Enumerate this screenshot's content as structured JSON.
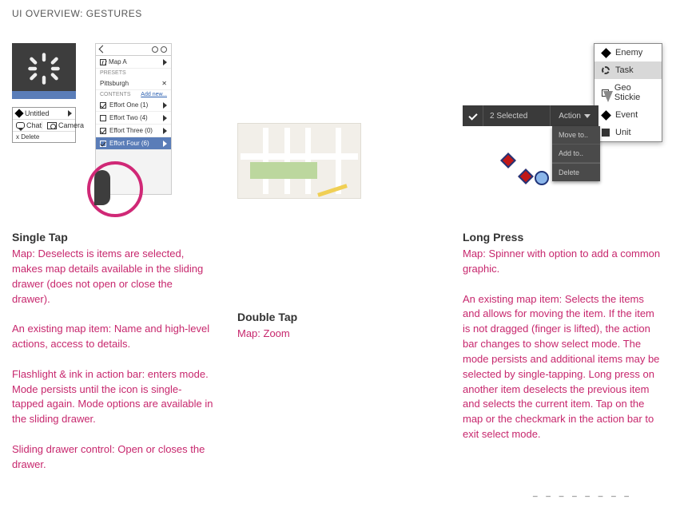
{
  "header": "UI OVERVIEW: GESTURES",
  "single_tap": {
    "title": "Single Tap",
    "desc": "Map: Deselects is items are selected, makes map details available in the sliding drawer (does not open or close the drawer).\n\nAn existing map item: Name and high-level actions, access to details.\n\nFlashlight & ink in action bar: enters mode. Mode persists until the icon is single-tapped again. Mode options are available in the sliding drawer.\n\nSliding drawer control: Open or closes the drawer.",
    "callout": {
      "item_name": "Untitled",
      "chat_label": "Chat",
      "camera_label": "Camera",
      "delete_label": "x Delete"
    },
    "panel": {
      "map_label": "Map A",
      "section1_label": "PRESETS",
      "preset_name": "Pittsburgh",
      "section2_label": "CONTENTS",
      "add_new": "Add new...",
      "rows": [
        {
          "label": "Effort One (1)",
          "checked": true
        },
        {
          "label": "Effort Two (4)",
          "checked": false
        },
        {
          "label": "Effort Three (0)",
          "checked": true
        },
        {
          "label": "Effort Four (6)",
          "checked": true
        }
      ]
    }
  },
  "double_tap": {
    "title": "Double Tap",
    "desc": "Map: Zoom"
  },
  "long_press": {
    "title": "Long Press",
    "desc": "Map: Spinner with option to add a common graphic.\n\nAn existing map item: Selects the items and allows for moving the item. If the item is not dragged (finger is lifted), the action bar changes to show select mode. The mode persists and additional items may be selected by single-tapping. Long press on another item deselects the previous item and selects the current item. Tap on the map or the checkmark in the action bar to exit select mode.",
    "actionbar": {
      "selected_text": "2 Selected",
      "action_label": "Action"
    },
    "menu": {
      "item1": "Move to..",
      "item2": "Add to..",
      "item3": "Delete"
    },
    "popup": {
      "items": [
        {
          "label": "Enemy",
          "icon": "diamond"
        },
        {
          "label": "Task",
          "icon": "circle-dashed",
          "selected": true
        },
        {
          "label": "Geo Stickie",
          "icon": "note"
        },
        {
          "label": "Event",
          "icon": "diamond"
        },
        {
          "label": "Unit",
          "icon": "square"
        }
      ]
    }
  },
  "footer_dashes": "_ _ _ _ _ _ _ _"
}
